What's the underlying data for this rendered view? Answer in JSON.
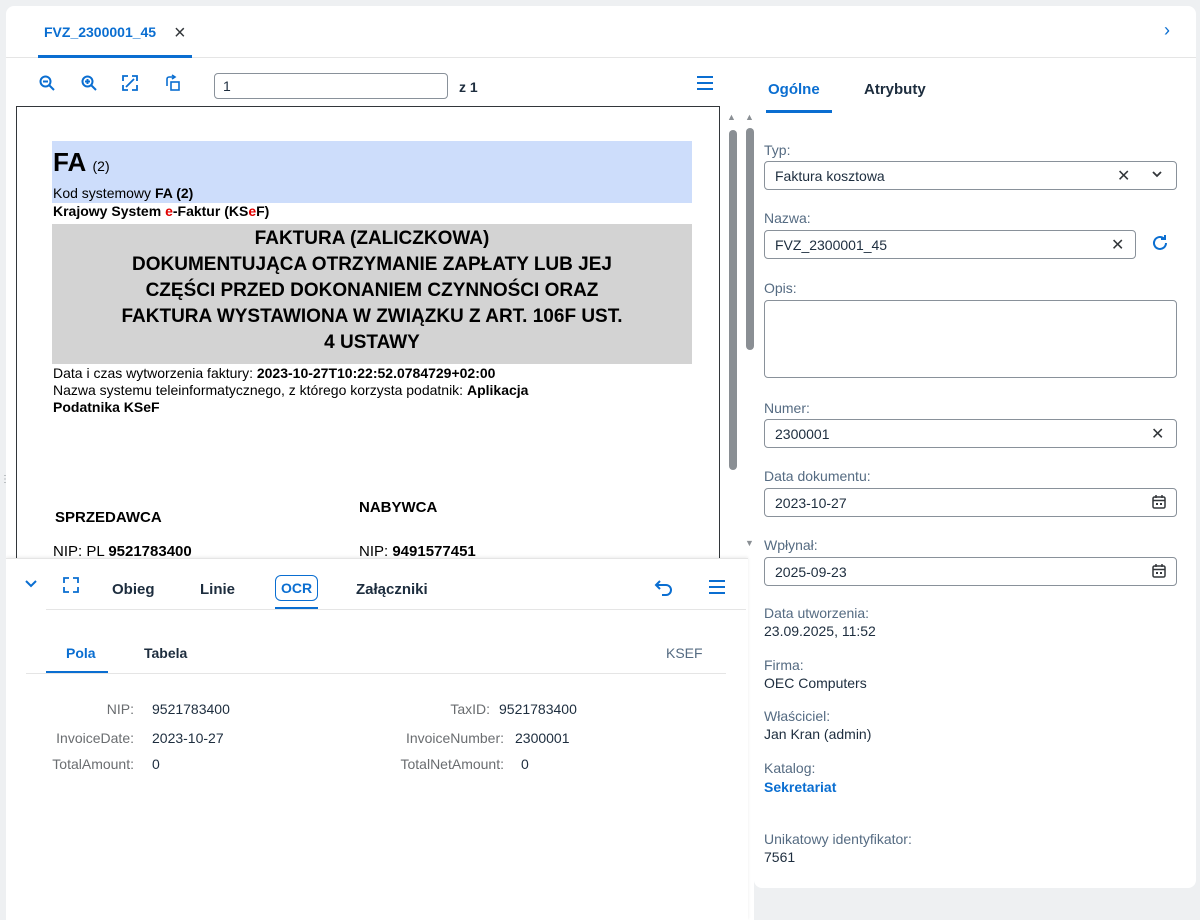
{
  "tab": {
    "title": "FVZ_2300001_45"
  },
  "viewer": {
    "page": "1",
    "of": "z 1"
  },
  "doc": {
    "fa": "FA",
    "fa_variant": "(2)",
    "kod_label": "Kod systemowy ",
    "kod_value": "FA (2)",
    "ksef_line_a": "Krajowy System ",
    "ksef_e": "e",
    "ksef_line_b": "-Faktur (KS",
    "ksef_e2": "e",
    "ksef_line_c": "F)",
    "title_lines": [
      "FAKTURA (ZALICZKOWA)",
      "DOKUMENTUJĄCA OTRZYMANIE ZAPŁATY LUB JEJ",
      "CZĘŚCI PRZED DOKONANIEM CZYNNOŚCI ORAZ",
      "FAKTURA WYSTAWIONA W ZWIĄZKU Z ART. 106F UST.",
      "4 USTAWY"
    ],
    "created_label": "Data i czas wytworzenia faktury: ",
    "created_value": "2023-10-27T10:22:52.0784729+02:00",
    "system_label": "Nazwa systemu teleinformatycznego, z którego korzysta podatnik: ",
    "system_value_1": "Aplikacja",
    "system_value_2": "Podatnika KSeF",
    "seller_heading": "SPRZEDAWCA",
    "buyer_heading": "NABYWCA",
    "seller_nip_label": "NIP: PL ",
    "seller_nip": "9521783400",
    "buyer_nip_label": "NIP: ",
    "buyer_nip": "9491577451"
  },
  "bottom": {
    "tabs": [
      "Obieg",
      "Linie",
      "OCR",
      "Załączniki"
    ],
    "subtabs": [
      "Pola",
      "Tabela"
    ],
    "source": "KSEF",
    "fields_left": [
      {
        "label": "NIP:",
        "value": "9521783400"
      },
      {
        "label": "InvoiceDate:",
        "value": "2023-10-27"
      },
      {
        "label": "TotalAmount:",
        "value": "0"
      }
    ],
    "fields_right": [
      {
        "label": "TaxID:",
        "value": "9521783400"
      },
      {
        "label": "InvoiceNumber:",
        "value": "2300001"
      },
      {
        "label": "TotalNetAmount:",
        "value": "0"
      }
    ]
  },
  "right": {
    "tabs": [
      "Ogólne",
      "Atrybuty"
    ],
    "typ_label": "Typ:",
    "typ_value": "Faktura kosztowa",
    "nazwa_label": "Nazwa:",
    "nazwa_value": "FVZ_2300001_45",
    "opis_label": "Opis:",
    "numer_label": "Numer:",
    "numer_value": "2300001",
    "data_dok_label": "Data dokumentu:",
    "data_dok_value": "2023-10-27",
    "wplynal_label": "Wpłynał:",
    "wplynal_value": "2025-09-23",
    "data_utw_label": "Data utworzenia:",
    "data_utw_value": "23.09.2025, 11:52",
    "firma_label": "Firma:",
    "firma_value": "OEC Computers",
    "wlasciciel_label": "Właściciel:",
    "wlasciciel_value": "Jan Kran (admin)",
    "katalog_label": "Katalog:",
    "katalog_value": "Sekretariat",
    "uid_label": "Unikatowy identyfikator:",
    "uid_value": "7561"
  },
  "colors": {
    "accent": "#0a6ed1",
    "doc_header_bg": "#cdddfb",
    "doc_title_bg": "#d3d3d3",
    "ksef_red": "#e00000"
  }
}
